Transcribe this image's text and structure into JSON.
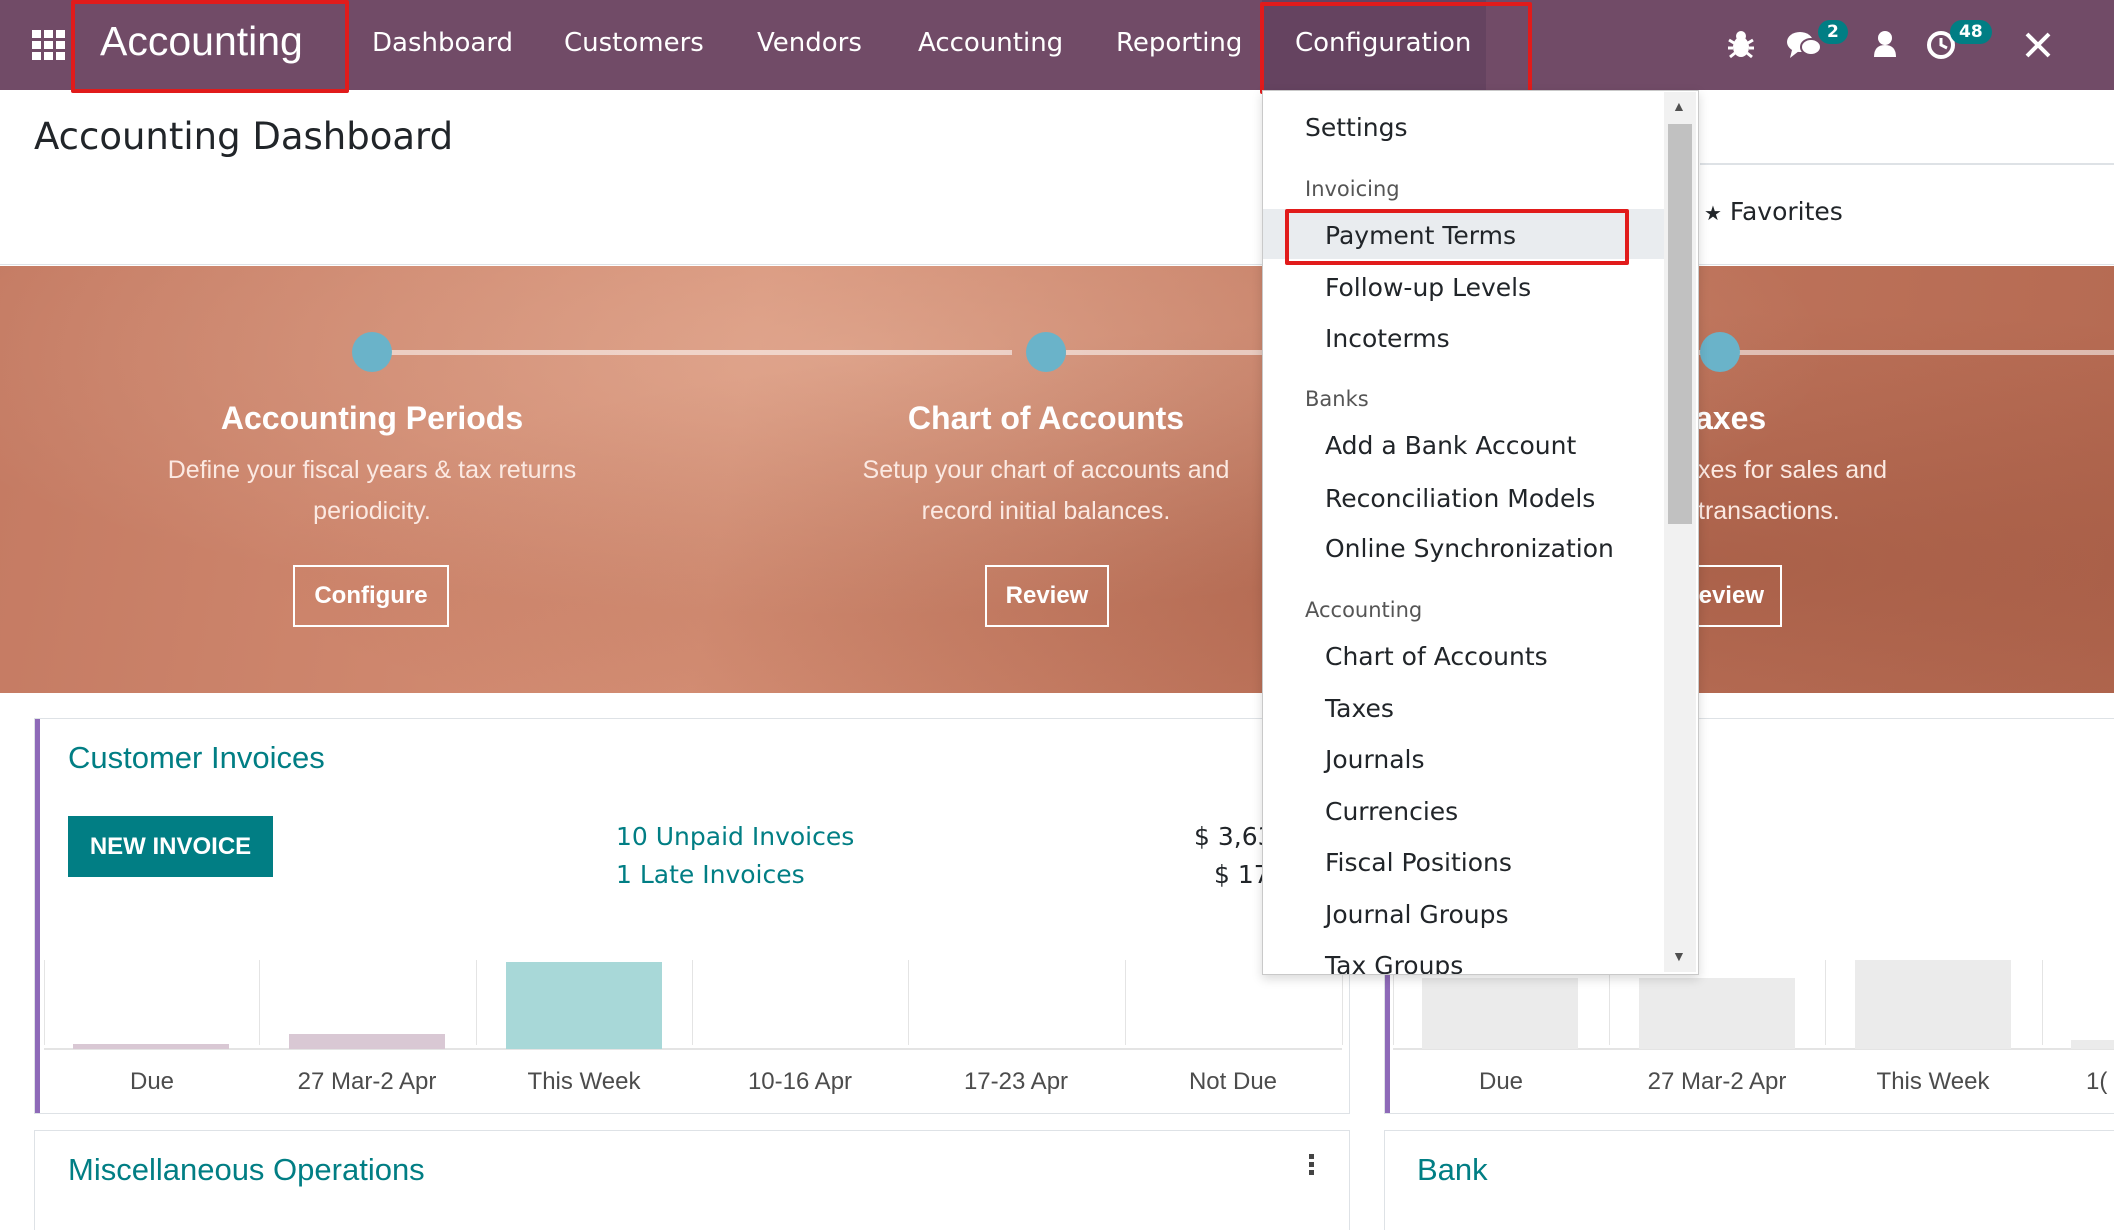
{
  "navbar": {
    "brand": "Accounting",
    "menu": [
      "Dashboard",
      "Customers",
      "Vendors",
      "Accounting",
      "Reporting",
      "Configuration"
    ],
    "messages_count": "2",
    "activities_count": "48"
  },
  "control_panel": {
    "title": "Accounting Dashboard",
    "favorites": "Favorites"
  },
  "onboarding": {
    "steps": [
      {
        "title": "Accounting Periods",
        "desc_line1": "Define your fiscal years & tax returns",
        "desc_line2": "periodicity.",
        "button": "Configure"
      },
      {
        "title": "Chart of Accounts",
        "desc_line1": "Setup your chart of accounts and",
        "desc_line2": "record initial balances.",
        "button": "Review"
      },
      {
        "title": "axes",
        "desc_line1": "xes for sales and",
        "desc_line2": "transactions.",
        "button": "eview"
      }
    ]
  },
  "customer_invoices": {
    "title": "Customer Invoices",
    "new_button": "NEW INVOICE",
    "unpaid": "10 Unpaid Invoices",
    "late": "1 Late Invoices",
    "unpaid_amount": "$ 3,63",
    "late_amount": "$ 17",
    "graph_labels": [
      "Due",
      "27 Mar-2 Apr",
      "This Week",
      "10-16 Apr",
      "17-23 Apr",
      "Not Due"
    ]
  },
  "vendor_graph": {
    "graph_labels": [
      "Due",
      "27 Mar-2 Apr",
      "This Week",
      "1("
    ]
  },
  "misc_operations": {
    "title": "Miscellaneous Operations"
  },
  "bank": {
    "title": "Bank"
  },
  "config_menu": {
    "settings": "Settings",
    "sections": [
      {
        "header": "Invoicing",
        "items": [
          "Payment Terms",
          "Follow-up Levels",
          "Incoterms"
        ]
      },
      {
        "header": "Banks",
        "items": [
          "Add a Bank Account",
          "Reconciliation Models",
          "Online Synchronization"
        ]
      },
      {
        "header": "Accounting",
        "items": [
          "Chart of Accounts",
          "Taxes",
          "Journals",
          "Currencies",
          "Fiscal Positions",
          "Journal Groups",
          "Tax Groups"
        ]
      }
    ],
    "highlighted": "Payment Terms"
  },
  "colors": {
    "navbar": "#714b67",
    "accent_teal": "#017e84",
    "highlight_box": "#e11b1b",
    "banner": "#c47a62"
  }
}
